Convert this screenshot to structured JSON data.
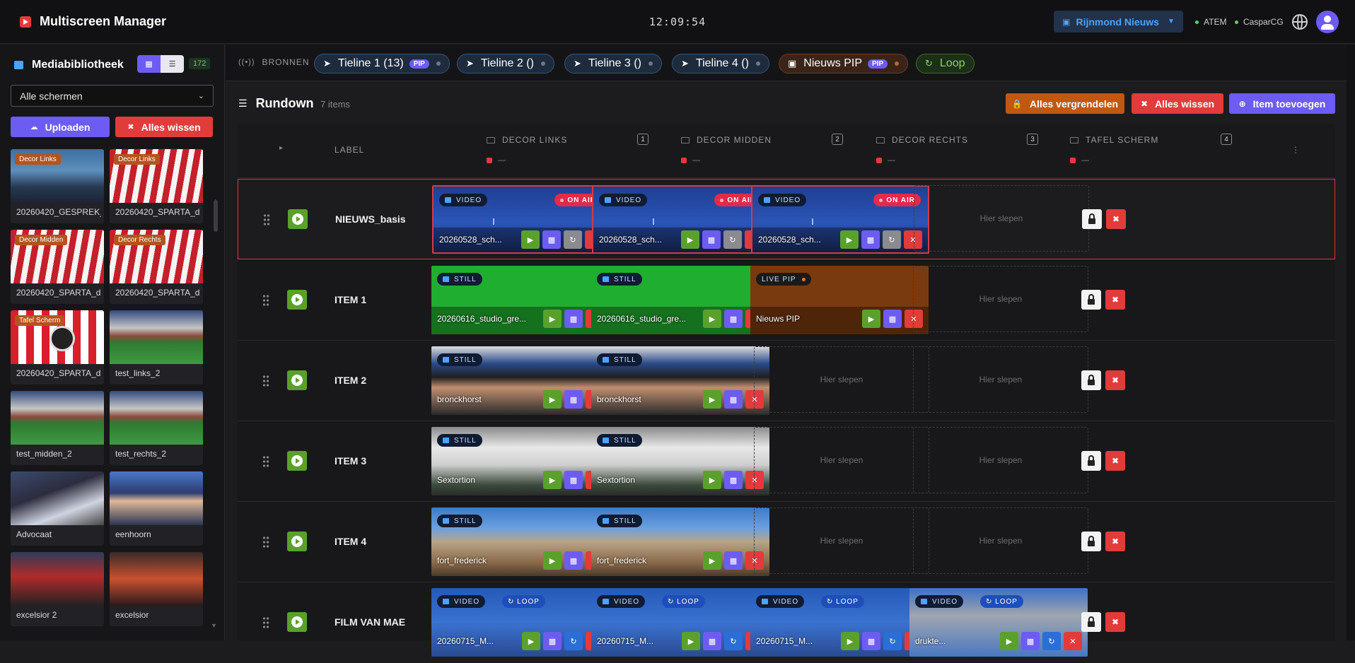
{
  "app": {
    "title": "Multiscreen Manager",
    "clock": "12:09:54",
    "station": "Rijnmond Nieuws"
  },
  "status": [
    {
      "label": "ATEM"
    },
    {
      "label": "CasparCG"
    }
  ],
  "sidebar": {
    "title": "Mediabibliotheek",
    "count": "172",
    "filter_value": "Alle schermen",
    "upload_label": "Uploaden",
    "clear_label": "Alles wissen",
    "items": [
      {
        "caption": "20260420_GESPREK_...",
        "tag": "Decor Links"
      },
      {
        "caption": "20260420_SPARTA_d...",
        "tag": "Decor Links"
      },
      {
        "caption": "20260420_SPARTA_d...",
        "tag": "Decor Midden"
      },
      {
        "caption": "20260420_SPARTA_d...",
        "tag": "Decor Rechts"
      },
      {
        "caption": "20260420_SPARTA_d...",
        "tag": "Tafel Scherm"
      },
      {
        "caption": "test_links_2",
        "tag": ""
      },
      {
        "caption": "test_midden_2",
        "tag": ""
      },
      {
        "caption": "test_rechts_2",
        "tag": ""
      },
      {
        "caption": "Advocaat",
        "tag": ""
      },
      {
        "caption": "eenhoorn",
        "tag": ""
      },
      {
        "caption": "excelsior 2",
        "tag": ""
      },
      {
        "caption": "excelsior",
        "tag": ""
      }
    ]
  },
  "sources": {
    "label": "BRONNEN",
    "pills": [
      {
        "label": "Tieline 1 (13)",
        "badge": "PIP"
      },
      {
        "label": "Tieline 2 ()",
        "badge": ""
      },
      {
        "label": "Tieline 3 ()",
        "badge": ""
      },
      {
        "label": "Tieline 4 ()",
        "badge": ""
      },
      {
        "label": "Nieuws PIP",
        "badge": "PIP"
      },
      {
        "label": "Loop",
        "badge": ""
      }
    ]
  },
  "rundown": {
    "title": "Rundown",
    "count": "7 items",
    "lock_all": "Alles vergrendelen",
    "clear_all": "Alles wissen",
    "add_item": "Item toevoegen",
    "label_header": "LABEL",
    "columns": [
      {
        "name": "DECOR LINKS",
        "num": "1",
        "sub": "—"
      },
      {
        "name": "DECOR MIDDEN",
        "num": "2",
        "sub": "—"
      },
      {
        "name": "DECOR RECHTS",
        "num": "3",
        "sub": "—"
      },
      {
        "name": "TAFEL SCHERM",
        "num": "4",
        "sub": "—"
      }
    ],
    "drop_text": "Hier slepen",
    "on_air": "ON AIR",
    "loop": "LOOP",
    "rows": [
      {
        "label": "NIEUWS_basis",
        "cells": [
          {
            "type": "VIDEO",
            "file": "20260528_sch...",
            "onair": true
          },
          {
            "type": "VIDEO",
            "file": "20260528_sch...",
            "onair": true
          },
          {
            "type": "VIDEO",
            "file": "20260528_sch...",
            "onair": true
          },
          null
        ]
      },
      {
        "label": "ITEM 1",
        "cells": [
          {
            "type": "STILL",
            "file": "20260616_studio_gre..."
          },
          {
            "type": "STILL",
            "file": "20260616_studio_gre..."
          },
          {
            "type": "LIVE PIP",
            "file": "Nieuws PIP"
          },
          null
        ]
      },
      {
        "label": "ITEM 2",
        "cells": [
          {
            "type": "STILL",
            "file": "bronckhorst"
          },
          {
            "type": "STILL",
            "file": "bronckhorst"
          },
          null,
          null
        ]
      },
      {
        "label": "ITEM 3",
        "cells": [
          {
            "type": "STILL",
            "file": "Sextortion"
          },
          {
            "type": "STILL",
            "file": "Sextortion"
          },
          null,
          null
        ]
      },
      {
        "label": "ITEM 4",
        "cells": [
          {
            "type": "STILL",
            "file": "fort_frederick"
          },
          {
            "type": "STILL",
            "file": "fort_frederick"
          },
          null,
          null
        ]
      },
      {
        "label": "FILM VAN MAE",
        "cells": [
          {
            "type": "VIDEO",
            "file": "20260715_M..."
          },
          {
            "type": "VIDEO",
            "file": "20260715_M..."
          },
          {
            "type": "VIDEO",
            "file": "20260715_M..."
          },
          {
            "type": "VIDEO",
            "file": "drukte..."
          }
        ]
      }
    ]
  },
  "colors": {
    "accent": "#6d5cf2",
    "danger": "#e23b3b",
    "success": "#5aa12c",
    "warning": "#c0580f",
    "brand_blue": "#4da3ff"
  }
}
